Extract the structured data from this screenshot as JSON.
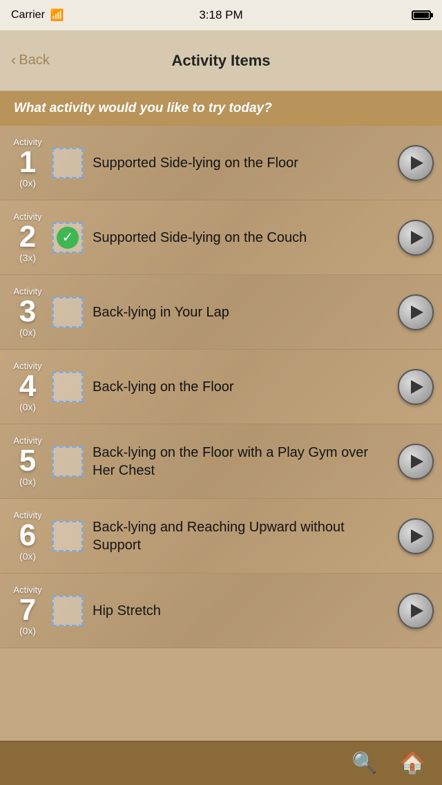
{
  "statusBar": {
    "carrier": "Carrier",
    "time": "3:18 PM"
  },
  "navBar": {
    "backLabel": "Back",
    "title": "Activity Items"
  },
  "questionBanner": {
    "text": "What activity would you like to try today?"
  },
  "activities": [
    {
      "id": 1,
      "label": "Activity",
      "number": "1",
      "count": "(0x)",
      "name": "Supported Side-lying on the Floor",
      "checked": false
    },
    {
      "id": 2,
      "label": "Activity",
      "number": "2",
      "count": "(3x)",
      "name": "Supported Side-lying on the Couch",
      "checked": true
    },
    {
      "id": 3,
      "label": "Activity",
      "number": "3",
      "count": "(0x)",
      "name": "Back-lying in Your Lap",
      "checked": false
    },
    {
      "id": 4,
      "label": "Activity",
      "number": "4",
      "count": "(0x)",
      "name": "Back-lying on the Floor",
      "checked": false
    },
    {
      "id": 5,
      "label": "Activity",
      "number": "5",
      "count": "(0x)",
      "name": "Back-lying on the Floor with a Play Gym over Her Chest",
      "checked": false
    },
    {
      "id": 6,
      "label": "Activity",
      "number": "6",
      "count": "(0x)",
      "name": "Back-lying and Reaching Upward without Support",
      "checked": false
    },
    {
      "id": 7,
      "label": "Activity",
      "number": "7",
      "count": "(0x)",
      "name": "Hip Stretch",
      "checked": false
    }
  ],
  "bottomBar": {
    "searchLabel": "search",
    "homeLabel": "home"
  }
}
